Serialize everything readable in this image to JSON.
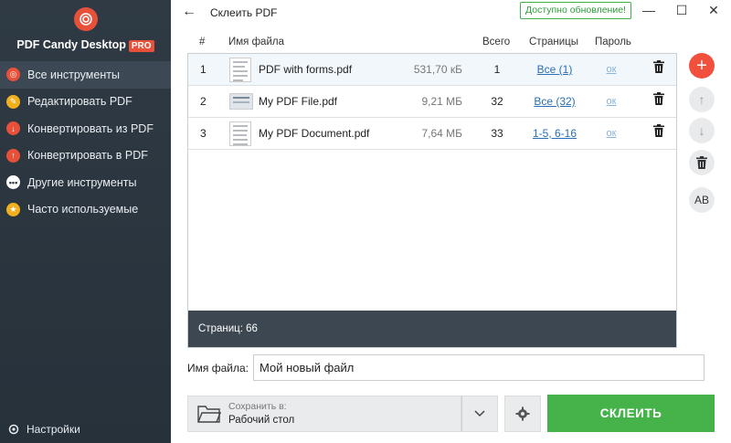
{
  "app": {
    "name": "PDF Candy Desktop",
    "badge": "PRO"
  },
  "sidebar": {
    "items": [
      {
        "label": "Все инструменты",
        "color": "#e8503a",
        "icon": "candy-icon"
      },
      {
        "label": "Редактировать PDF",
        "color": "#f2b01e",
        "icon": "edit-icon"
      },
      {
        "label": "Конвертировать из PDF",
        "color": "#e8503a",
        "icon": "download-icon"
      },
      {
        "label": "Конвертировать в PDF",
        "color": "#e8503a",
        "icon": "upload-icon"
      },
      {
        "label": "Другие инструменты",
        "color": "#ffffff",
        "icon": "more-icon"
      },
      {
        "label": "Часто используемые",
        "color": "#f2b01e",
        "icon": "star-icon"
      }
    ],
    "settings": "Настройки"
  },
  "topbar": {
    "title": "Склеить PDF",
    "update": "Доступно обновление!"
  },
  "table": {
    "headers": {
      "num": "#",
      "name": "Имя файла",
      "total": "Всего",
      "pages": "Страницы",
      "password": "Пароль"
    },
    "rows": [
      {
        "num": "1",
        "name": "PDF with forms.pdf",
        "size": "531,70 кБ",
        "total": "1",
        "pages": "Все (1)",
        "password": "ок"
      },
      {
        "num": "2",
        "name": "My PDF File.pdf",
        "size": "9,21 МБ",
        "total": "32",
        "pages": "Все (32)",
        "password": "ок"
      },
      {
        "num": "3",
        "name": "My PDF Document.pdf",
        "size": "7,64 МБ",
        "total": "33",
        "pages": "1-5, 6-16",
        "password": "ок"
      }
    ],
    "footer": "Страниц: 66"
  },
  "filename": {
    "label": "Имя файла:",
    "value": "Мой новый файл"
  },
  "save": {
    "label": "Сохранить в:",
    "value": "Рабочий стол"
  },
  "merge_button": "СКЛЕИТЬ",
  "side_buttons": {
    "sort_label": "AB"
  }
}
